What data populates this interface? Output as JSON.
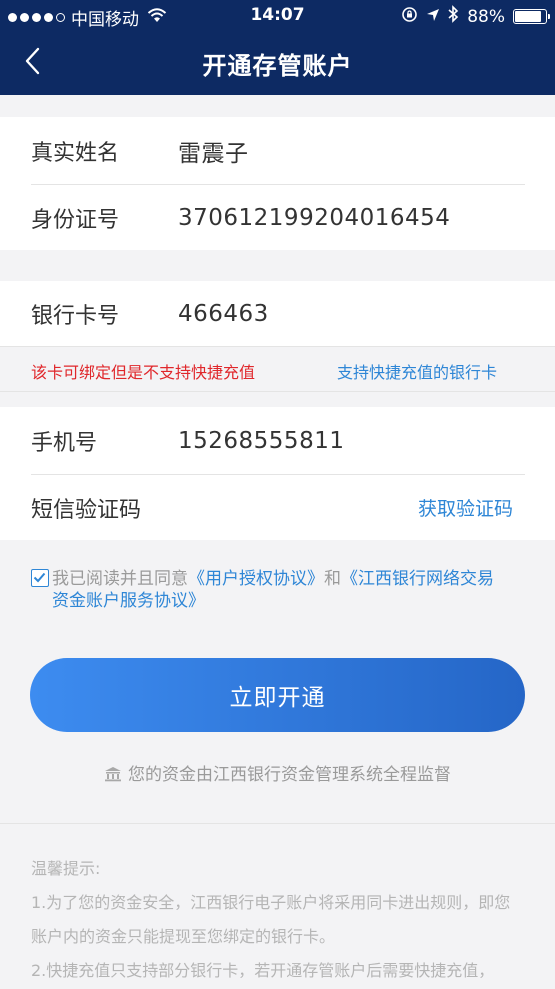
{
  "status_bar": {
    "carrier": "中国移动",
    "time": "14:07",
    "battery": "88%"
  },
  "header": {
    "title": "开通存管账户"
  },
  "identity": {
    "name_label": "真实姓名",
    "name_value": "雷震子",
    "id_label": "身份证号",
    "id_value": "370612199204016454"
  },
  "bank": {
    "card_label": "银行卡号",
    "card_value": "466463",
    "warning": "该卡可绑定但是不支持快捷充值",
    "supported_link": "支持快捷充值的银行卡"
  },
  "phone": {
    "phone_label": "手机号",
    "phone_value": "15268555811",
    "sms_label": "短信验证码",
    "get_code": "获取验证码"
  },
  "agreement": {
    "prefix": "我已阅读并且同意",
    "link1": "《用户授权协议》",
    "and": "和",
    "link2a": "《江西银行网络交易",
    "link2b": "资金账户服务协议》",
    "checked": true
  },
  "primary_button": "立即开通",
  "supervision_text": "您的资金由江西银行资金管理系统全程监督",
  "tips": {
    "title": "温馨提示:",
    "line1": "1.为了您的资金安全，江西银行电子账户将采用同卡进出规则，即您",
    "line2": "账户内的资金只能提现至您绑定的银行卡。",
    "line3": "2.快捷充值只支持部分银行卡，若开通存管账户后需要快捷充值，"
  },
  "colors": {
    "header_bg": "#0d2a63",
    "accent": "#2e86d6",
    "warning": "#e0272b"
  }
}
